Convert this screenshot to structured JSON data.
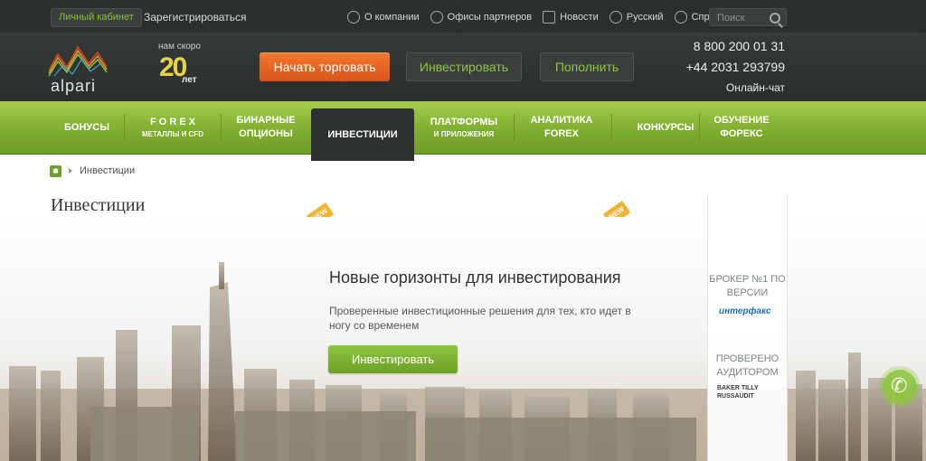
{
  "topbar": {
    "cabinet": "Личный кабинет",
    "register": "Зарегистрироваться",
    "links": [
      {
        "icon": "gear-icon",
        "label": "О компании"
      },
      {
        "icon": "people-icon",
        "label": "Офисы партнеров"
      },
      {
        "icon": "document-icon",
        "label": "Новости"
      },
      {
        "icon": "globe-icon",
        "label": "Русский"
      },
      {
        "icon": "help-icon",
        "label": "Справка"
      }
    ],
    "search_placeholder": "Поиск"
  },
  "header": {
    "brand": "alpari",
    "anniv_soon": "нам скоро",
    "anniv_num": "20",
    "anniv_years": "лет",
    "btn_start": "Начать торговать",
    "btn_invest": "Инвестировать",
    "btn_fund": "Пополнить",
    "phone1": "8 800 200 01 31",
    "phone2": "+44 2031 293799",
    "chat": "Онлайн-чат"
  },
  "nav": {
    "items": [
      {
        "label": "БОНУСЫ",
        "sub": ""
      },
      {
        "label": "F O R E X",
        "sub": "МЕТАЛЛЫ И CFD"
      },
      {
        "label": "БИНАРНЫЕ ОПЦИОНЫ",
        "sub": ""
      },
      {
        "label": "ИНВЕСТИЦИИ",
        "sub": ""
      },
      {
        "label": "ПЛАТФОРМЫ",
        "sub": "И ПРИЛОЖЕНИЯ"
      },
      {
        "label": "АНАЛИТИКА FOREX",
        "sub": ""
      },
      {
        "label": "КОНКУРСЫ",
        "sub": ""
      },
      {
        "label": "ОБУЧЕНИЕ ФОРЕКС",
        "sub": ""
      }
    ],
    "badge": "NEW"
  },
  "breadcrumb": {
    "current": "Инвестиции"
  },
  "page": {
    "title": "Инвестиции"
  },
  "hero": {
    "title": "Новые горизонты для инвестирования",
    "text": "Проверенные инвестиционные решения для тех, кто идет в ногу со временем",
    "button": "Инвестировать"
  },
  "sidepanel": {
    "broker": "БРОКЕР №1 ПО ВЕРСИИ",
    "interfax": "интерфакс",
    "audit": "ПРОВЕРЕНО АУДИТОРОМ",
    "baker": "BAKER TILLY RUSSAUDIT"
  },
  "colors": {
    "accent_green": "#8ec63f",
    "accent_orange": "#e8631f",
    "dark": "#2b2f2d"
  }
}
